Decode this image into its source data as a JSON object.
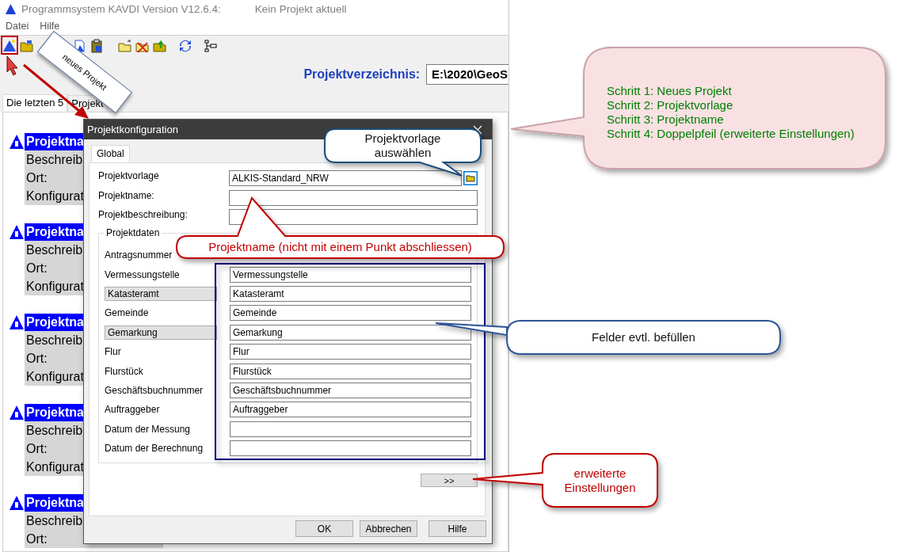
{
  "window": {
    "title": "Programmsystem KAVDI Version V12.6.4:",
    "status": "Kein Projekt aktuell"
  },
  "menu": [
    "Datei",
    "Hilfe"
  ],
  "project_dir": {
    "label": "Projektverzeichnis:",
    "value": "E:\\2020\\GeoS"
  },
  "tabs": [
    {
      "label": "Die letzten 5",
      "selected": true
    },
    {
      "label": "Projekt",
      "selected": false
    }
  ],
  "recent_projects": [
    {
      "title": "Projektna",
      "lines": [
        "Beschreib",
        "Ort:",
        "Konfigurat"
      ]
    },
    {
      "title": "Projektna",
      "lines": [
        "Beschreib",
        "Ort:",
        "Konfigurat"
      ]
    },
    {
      "title": "Projektna",
      "lines": [
        "Beschreib",
        "Ort:",
        "Konfigurat"
      ]
    },
    {
      "title": "Projektna",
      "lines": [
        "Beschreib",
        "Ort:",
        "Konfigurat"
      ]
    },
    {
      "title": "Projektna",
      "lines": [
        "Beschreib",
        "Ort:"
      ]
    }
  ],
  "dialog": {
    "title": "Projektkonfiguration",
    "tabs": [
      {
        "label": "Global",
        "selected": true
      }
    ],
    "fields": [
      {
        "label": "Projektvorlage",
        "kind": "browse",
        "value": "ALKIS-Standard_NRW"
      },
      {
        "label": "Projektname:",
        "kind": "text"
      },
      {
        "label": "Projektbeschreibung:",
        "kind": "text"
      }
    ],
    "group": {
      "title": "Projektdaten",
      "rows": [
        {
          "label": "Antragsnummer",
          "kind": "covered"
        },
        {
          "label": "Vermessungstelle",
          "kind": "text",
          "value": "Vermessungstelle"
        },
        {
          "label": "Katasteramt",
          "kind": "button",
          "value": "Katasteramt"
        },
        {
          "label": "Gemeinde",
          "kind": "text",
          "value": "Gemeinde"
        },
        {
          "label": "Gemarkung",
          "kind": "button",
          "value": "Gemarkung"
        },
        {
          "label": "Flur",
          "kind": "text",
          "value": "Flur"
        },
        {
          "label": "Flurstück",
          "kind": "text",
          "value": "Flurstück"
        },
        {
          "label": "Geschäftsbuchnummer",
          "kind": "text",
          "value": "Geschäftsbuchnummer"
        },
        {
          "label": "Auftraggeber",
          "kind": "text",
          "value": "Auftraggeber"
        },
        {
          "label": "Datum der Messung",
          "kind": "text"
        },
        {
          "label": "Datum der Berechnung",
          "kind": "text"
        }
      ]
    },
    "more_button": ">>",
    "buttons": [
      "OK",
      "Abbrechen",
      "Hilfe"
    ]
  },
  "callouts": [
    {
      "kind": "note",
      "lines": [
        "neues Projekt"
      ]
    },
    {
      "kind": "template",
      "lines": [
        "Projektvorlage",
        "auswählen"
      ]
    },
    {
      "kind": "name",
      "lines": [
        "Projektname (nicht mit einem Punkt abschliessen)"
      ]
    },
    {
      "kind": "steps",
      "lines": [
        "Schritt 1: Neues Projekt",
        "Schritt 2: Projektvorlage",
        "Schritt 3: Projektname",
        "Schritt 4: Doppelpfeil (erweiterte Einstellungen)"
      ]
    },
    {
      "kind": "fields",
      "lines": [
        "Felder evtl. befüllen"
      ]
    },
    {
      "kind": "advanced",
      "lines": [
        "erweiterte",
        "Einstellungen"
      ]
    }
  ]
}
